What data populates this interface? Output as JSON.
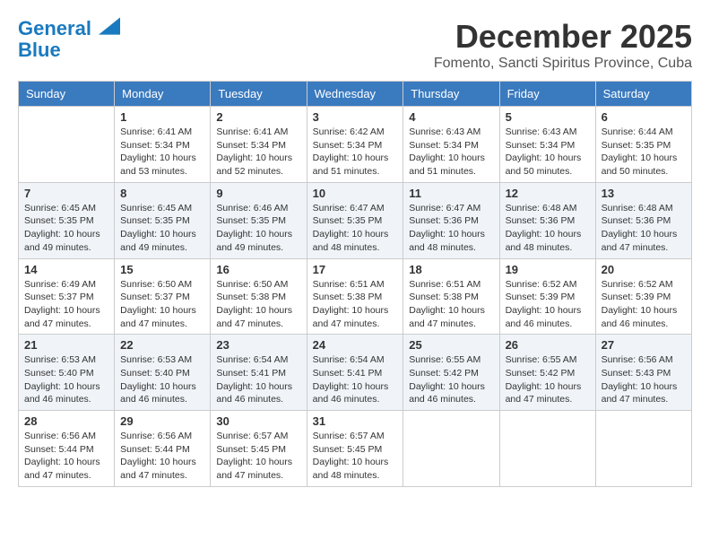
{
  "logo": {
    "line1": "General",
    "line2": "Blue"
  },
  "title": "December 2025",
  "subtitle": "Fomento, Sancti Spiritus Province, Cuba",
  "weekdays": [
    "Sunday",
    "Monday",
    "Tuesday",
    "Wednesday",
    "Thursday",
    "Friday",
    "Saturday"
  ],
  "weeks": [
    [
      {
        "day": "",
        "info": ""
      },
      {
        "day": "1",
        "info": "Sunrise: 6:41 AM\nSunset: 5:34 PM\nDaylight: 10 hours\nand 53 minutes."
      },
      {
        "day": "2",
        "info": "Sunrise: 6:41 AM\nSunset: 5:34 PM\nDaylight: 10 hours\nand 52 minutes."
      },
      {
        "day": "3",
        "info": "Sunrise: 6:42 AM\nSunset: 5:34 PM\nDaylight: 10 hours\nand 51 minutes."
      },
      {
        "day": "4",
        "info": "Sunrise: 6:43 AM\nSunset: 5:34 PM\nDaylight: 10 hours\nand 51 minutes."
      },
      {
        "day": "5",
        "info": "Sunrise: 6:43 AM\nSunset: 5:34 PM\nDaylight: 10 hours\nand 50 minutes."
      },
      {
        "day": "6",
        "info": "Sunrise: 6:44 AM\nSunset: 5:35 PM\nDaylight: 10 hours\nand 50 minutes."
      }
    ],
    [
      {
        "day": "7",
        "info": "Sunrise: 6:45 AM\nSunset: 5:35 PM\nDaylight: 10 hours\nand 49 minutes."
      },
      {
        "day": "8",
        "info": "Sunrise: 6:45 AM\nSunset: 5:35 PM\nDaylight: 10 hours\nand 49 minutes."
      },
      {
        "day": "9",
        "info": "Sunrise: 6:46 AM\nSunset: 5:35 PM\nDaylight: 10 hours\nand 49 minutes."
      },
      {
        "day": "10",
        "info": "Sunrise: 6:47 AM\nSunset: 5:35 PM\nDaylight: 10 hours\nand 48 minutes."
      },
      {
        "day": "11",
        "info": "Sunrise: 6:47 AM\nSunset: 5:36 PM\nDaylight: 10 hours\nand 48 minutes."
      },
      {
        "day": "12",
        "info": "Sunrise: 6:48 AM\nSunset: 5:36 PM\nDaylight: 10 hours\nand 48 minutes."
      },
      {
        "day": "13",
        "info": "Sunrise: 6:48 AM\nSunset: 5:36 PM\nDaylight: 10 hours\nand 47 minutes."
      }
    ],
    [
      {
        "day": "14",
        "info": "Sunrise: 6:49 AM\nSunset: 5:37 PM\nDaylight: 10 hours\nand 47 minutes."
      },
      {
        "day": "15",
        "info": "Sunrise: 6:50 AM\nSunset: 5:37 PM\nDaylight: 10 hours\nand 47 minutes."
      },
      {
        "day": "16",
        "info": "Sunrise: 6:50 AM\nSunset: 5:38 PM\nDaylight: 10 hours\nand 47 minutes."
      },
      {
        "day": "17",
        "info": "Sunrise: 6:51 AM\nSunset: 5:38 PM\nDaylight: 10 hours\nand 47 minutes."
      },
      {
        "day": "18",
        "info": "Sunrise: 6:51 AM\nSunset: 5:38 PM\nDaylight: 10 hours\nand 47 minutes."
      },
      {
        "day": "19",
        "info": "Sunrise: 6:52 AM\nSunset: 5:39 PM\nDaylight: 10 hours\nand 46 minutes."
      },
      {
        "day": "20",
        "info": "Sunrise: 6:52 AM\nSunset: 5:39 PM\nDaylight: 10 hours\nand 46 minutes."
      }
    ],
    [
      {
        "day": "21",
        "info": "Sunrise: 6:53 AM\nSunset: 5:40 PM\nDaylight: 10 hours\nand 46 minutes."
      },
      {
        "day": "22",
        "info": "Sunrise: 6:53 AM\nSunset: 5:40 PM\nDaylight: 10 hours\nand 46 minutes."
      },
      {
        "day": "23",
        "info": "Sunrise: 6:54 AM\nSunset: 5:41 PM\nDaylight: 10 hours\nand 46 minutes."
      },
      {
        "day": "24",
        "info": "Sunrise: 6:54 AM\nSunset: 5:41 PM\nDaylight: 10 hours\nand 46 minutes."
      },
      {
        "day": "25",
        "info": "Sunrise: 6:55 AM\nSunset: 5:42 PM\nDaylight: 10 hours\nand 46 minutes."
      },
      {
        "day": "26",
        "info": "Sunrise: 6:55 AM\nSunset: 5:42 PM\nDaylight: 10 hours\nand 47 minutes."
      },
      {
        "day": "27",
        "info": "Sunrise: 6:56 AM\nSunset: 5:43 PM\nDaylight: 10 hours\nand 47 minutes."
      }
    ],
    [
      {
        "day": "28",
        "info": "Sunrise: 6:56 AM\nSunset: 5:44 PM\nDaylight: 10 hours\nand 47 minutes."
      },
      {
        "day": "29",
        "info": "Sunrise: 6:56 AM\nSunset: 5:44 PM\nDaylight: 10 hours\nand 47 minutes."
      },
      {
        "day": "30",
        "info": "Sunrise: 6:57 AM\nSunset: 5:45 PM\nDaylight: 10 hours\nand 47 minutes."
      },
      {
        "day": "31",
        "info": "Sunrise: 6:57 AM\nSunset: 5:45 PM\nDaylight: 10 hours\nand 48 minutes."
      },
      {
        "day": "",
        "info": ""
      },
      {
        "day": "",
        "info": ""
      },
      {
        "day": "",
        "info": ""
      }
    ]
  ]
}
